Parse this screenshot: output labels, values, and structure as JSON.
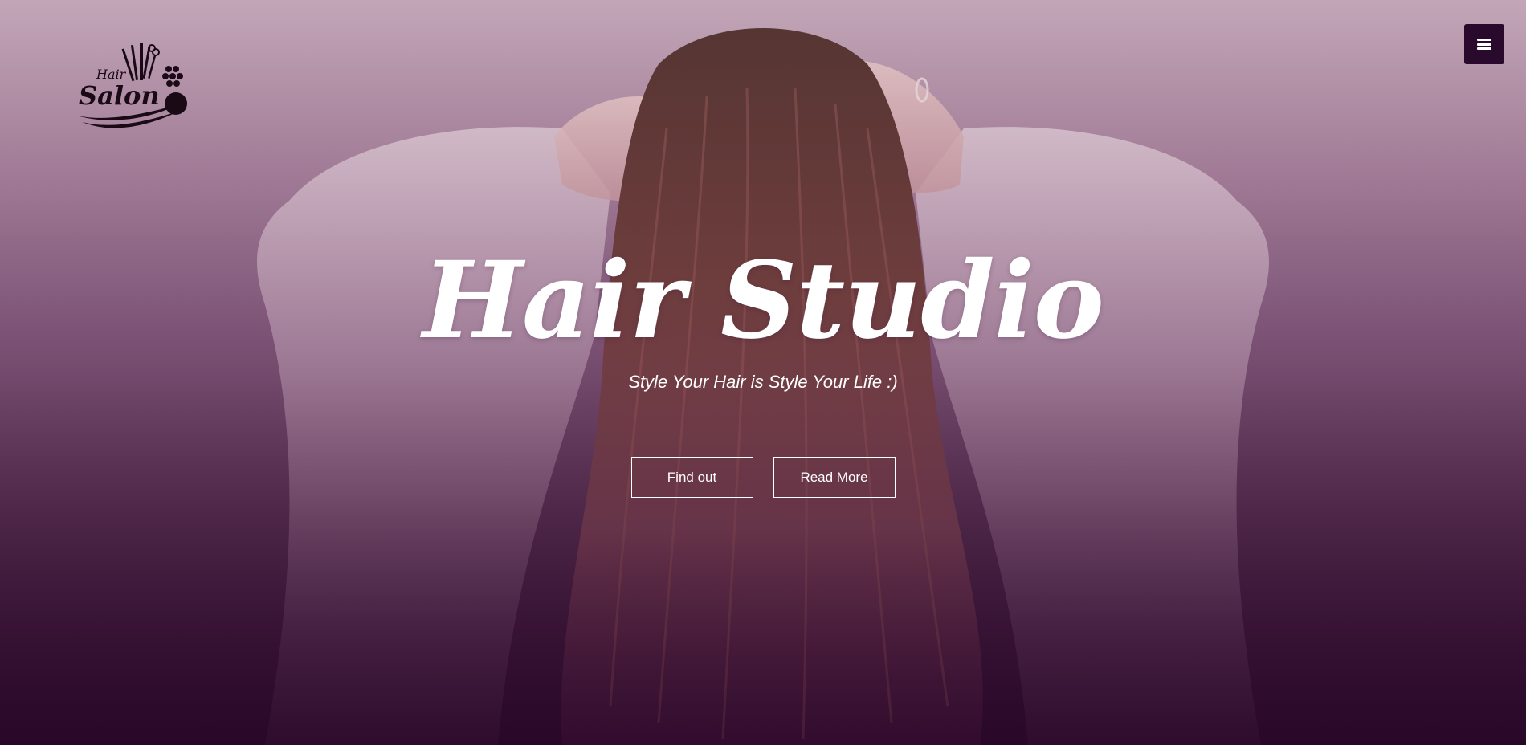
{
  "header": {
    "logo": {
      "top_word": "Hair",
      "main_word": "Salon"
    },
    "menu_icon": "hamburger-icon"
  },
  "hero": {
    "title": "Hair Studio",
    "subtitle": "Style Your Hair is Style Your Life :)",
    "buttons": {
      "find_out_label": "Find out",
      "read_more_label": "Read More"
    }
  },
  "colors": {
    "menu_background": "#2a0a2c",
    "overlay_top": "#c3a7b8",
    "overlay_bottom": "#2a0a29",
    "text": "#ffffff"
  }
}
